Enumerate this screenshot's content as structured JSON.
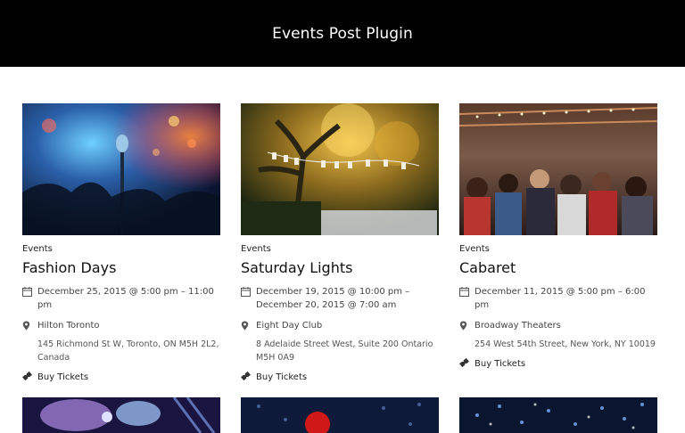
{
  "header": {
    "title": "Events Post Plugin"
  },
  "events": [
    {
      "category": "Events",
      "title": "Fashion Days",
      "date": "December 25, 2015 @ 5:00 pm – 11:00 pm",
      "venue": "Hilton Toronto",
      "address": "145 Richmond St W, Toronto, ON M5H 2L2, Canada",
      "tickets_label": "Buy Tickets"
    },
    {
      "category": "Events",
      "title": "Saturday Lights",
      "date": "December 19, 2015 @ 10:00 pm – December 20, 2015 @ 7:00 am",
      "venue": "Eight Day Club",
      "address": "8 Adelaide Street West, Suite 200 Ontario M5H 0A9",
      "tickets_label": "Buy Tickets"
    },
    {
      "category": "Events",
      "title": "Cabaret",
      "date": "December 11, 2015 @ 5:00 pm – 6:00 pm",
      "venue": "Broadway Theaters",
      "address": "254 West 54th Street, New York, NY 10019",
      "tickets_label": "Buy Tickets"
    }
  ],
  "icons": {
    "date": "calendar-icon",
    "venue": "map-pin-icon",
    "tickets": "ticket-icon"
  }
}
